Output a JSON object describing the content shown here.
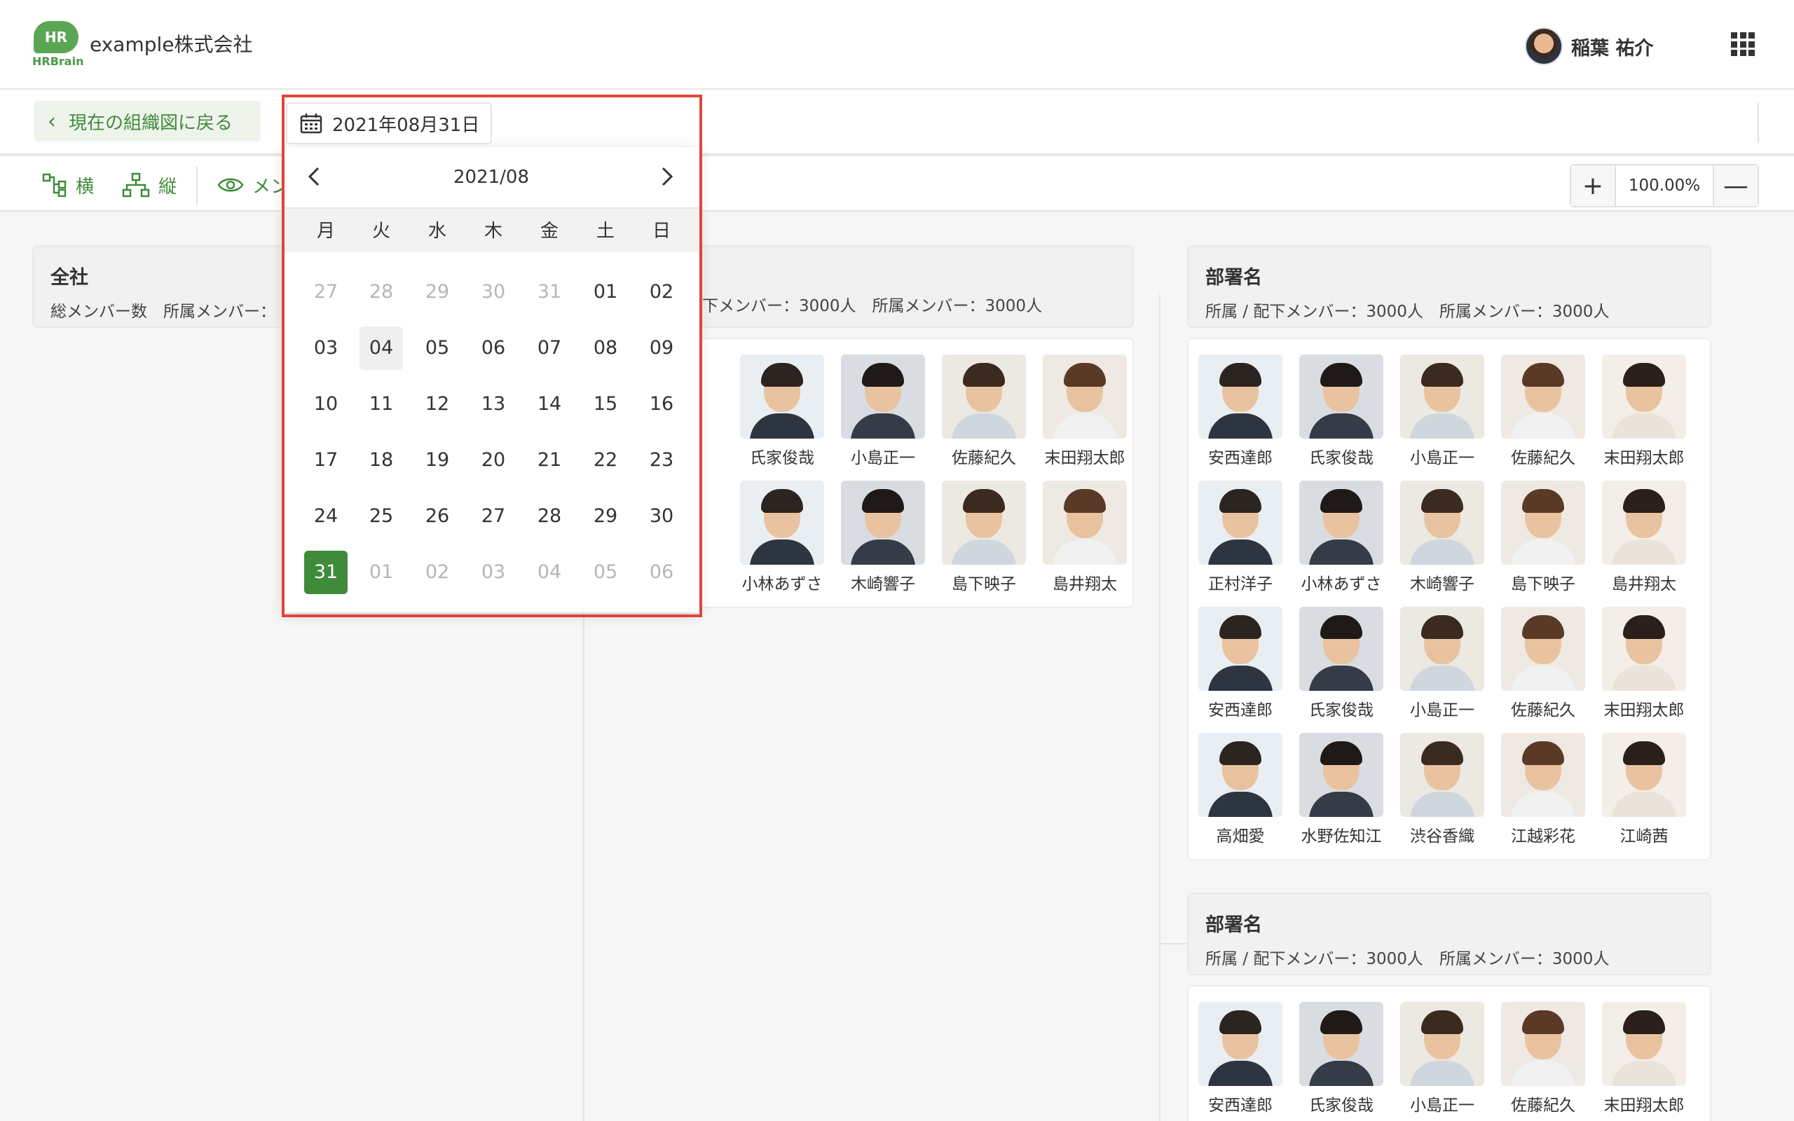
{
  "header": {
    "logo_text": "HR",
    "logo_sub": "HRBrain",
    "company": "example株式会社",
    "user_name": "稲葉 祐介",
    "apps_icon": "grid-icon"
  },
  "toolbar": {
    "back_label": "現在の組織図に戻る",
    "date_value": "2021年08月31日",
    "view_horizontal": "横",
    "view_vertical": "縦",
    "view_members": "メン",
    "zoom_value": "100.00%"
  },
  "calendar": {
    "month_label": "2021/08",
    "weekdays": [
      "月",
      "火",
      "水",
      "木",
      "金",
      "土",
      "日"
    ],
    "weeks": [
      [
        "27",
        "28",
        "29",
        "30",
        "31",
        "01",
        "02"
      ],
      [
        "03",
        "04",
        "05",
        "06",
        "07",
        "08",
        "09"
      ],
      [
        "10",
        "11",
        "12",
        "13",
        "14",
        "15",
        "16"
      ],
      [
        "17",
        "18",
        "19",
        "20",
        "21",
        "22",
        "23"
      ],
      [
        "24",
        "25",
        "26",
        "27",
        "28",
        "29",
        "30"
      ],
      [
        "31",
        "01",
        "02",
        "03",
        "04",
        "05",
        "06"
      ]
    ],
    "selected": "31",
    "today": "04"
  },
  "org": {
    "root": {
      "name": "全社",
      "stats": "総メンバー数　所属メンバー："
    },
    "dept_middle": {
      "stats": "下メンバー：3000人　所属メンバー：3000人"
    },
    "dept_right_1": {
      "name": "部署名",
      "stats": "所属 / 配下メンバー：3000人　所属メンバー：3000人"
    },
    "dept_right_2": {
      "name": "部署名",
      "stats": "所属 / 配下メンバー：3000人　所属メンバー：3000人"
    },
    "middle_members": [
      [
        "氏家俊哉",
        "小島正一",
        "佐藤紀久",
        "末田翔太郎"
      ],
      [
        "小林あずさ",
        "木崎響子",
        "島下映子",
        "島井翔太"
      ]
    ],
    "right1_members": [
      [
        "安西達郎",
        "氏家俊哉",
        "小島正一",
        "佐藤紀久",
        "末田翔太郎"
      ],
      [
        "正村洋子",
        "小林あずさ",
        "木崎響子",
        "島下映子",
        "島井翔太"
      ],
      [
        "安西達郎",
        "氏家俊哉",
        "小島正一",
        "佐藤紀久",
        "末田翔太郎"
      ],
      [
        "高畑愛",
        "水野佐知江",
        "渋谷香織",
        "江越彩花",
        "江崎茜"
      ]
    ],
    "right2_members": [
      [
        "安西達郎",
        "氏家俊哉",
        "小島正一",
        "佐藤紀久",
        "末田翔太郎"
      ]
    ]
  }
}
